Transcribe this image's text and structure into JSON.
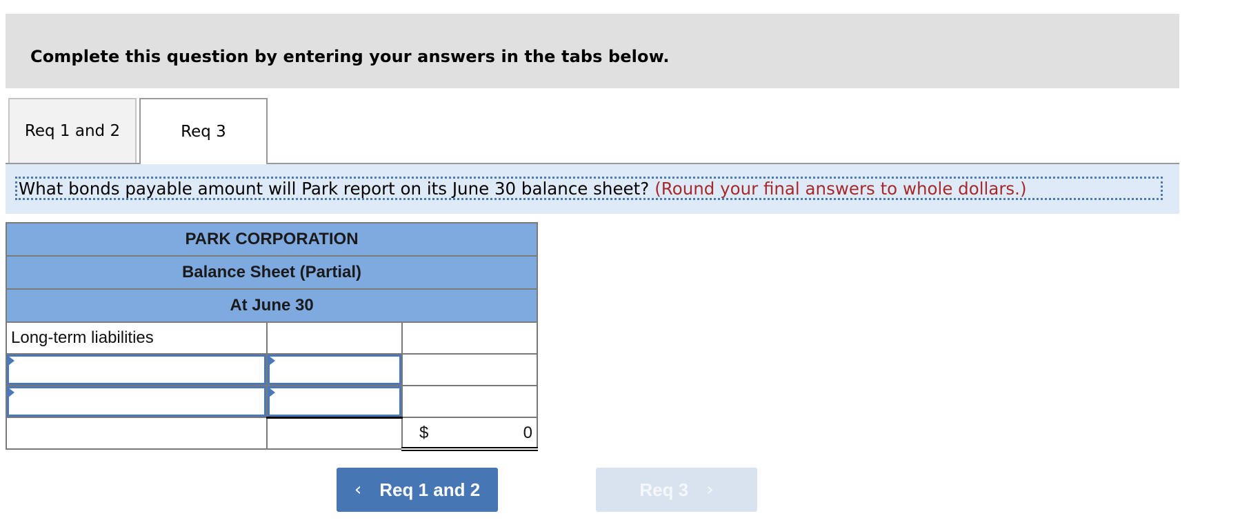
{
  "instruction": {
    "text": "Complete this question by entering your answers in the tabs below."
  },
  "tabs": [
    {
      "label": "Req 1 and 2",
      "active": false
    },
    {
      "label": "Req 3",
      "active": true
    }
  ],
  "question": {
    "text": "What bonds payable amount will Park report on its June 30 balance sheet?",
    "hint": "(Round your final answers to whole dollars.)",
    "hint_color": "#a52a2a"
  },
  "balance_sheet": {
    "company": "PARK CORPORATION",
    "statement": "Balance Sheet (Partial)",
    "date": "At June 30",
    "header_color": "#7faadf",
    "section_label": "Long-term liabilities",
    "input_rows": [
      {
        "label_value": "",
        "amount_value": ""
      },
      {
        "label_value": "",
        "amount_value": ""
      }
    ],
    "total": {
      "currency": "$",
      "amount": "0"
    }
  },
  "navigation": {
    "prev": {
      "label": "Req 1 and 2",
      "icon": "chevron-left-icon",
      "glyph": "‹",
      "enabled": true,
      "color": "#4676b4"
    },
    "next": {
      "label": "Req 3",
      "icon": "chevron-right-icon",
      "glyph": "›",
      "enabled": false,
      "color": "#d9e3ef"
    }
  }
}
